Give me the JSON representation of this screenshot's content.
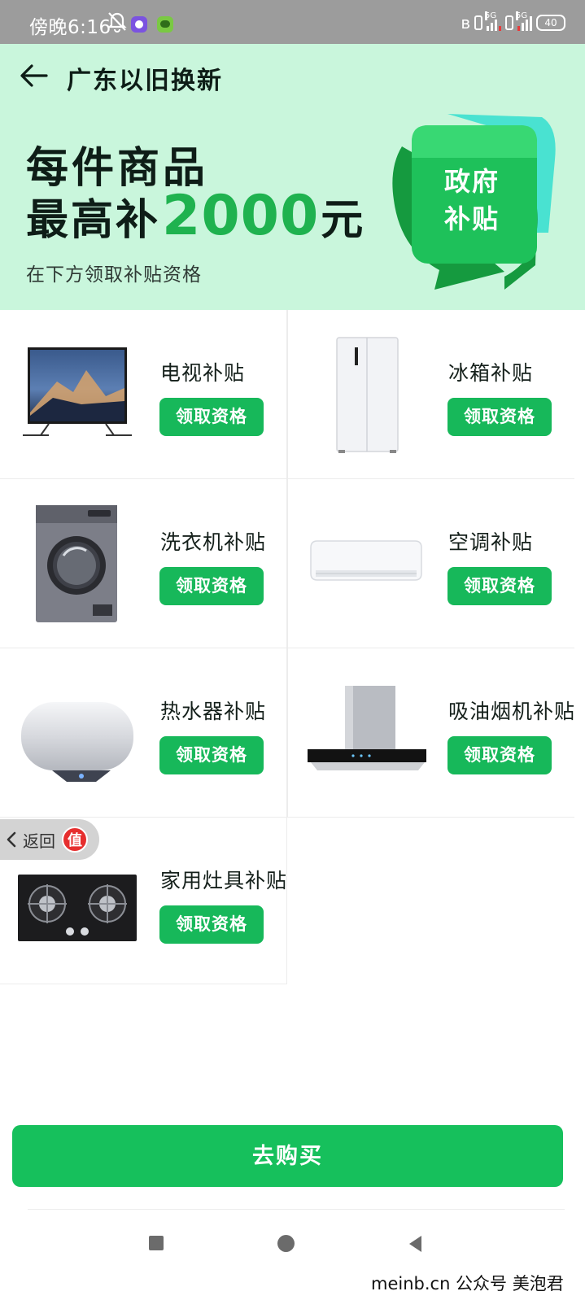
{
  "status_bar": {
    "time": "傍晚6:16",
    "network1": "5G",
    "network2": "5G",
    "battery": "40"
  },
  "header": {
    "title": "广东以旧换新"
  },
  "banner": {
    "line1": "每件商品",
    "line2_prefix": "最高补",
    "line2_amount": "2000",
    "line2_suffix": "元",
    "subtitle": "在下方领取补贴资格",
    "badge_line1": "政府",
    "badge_line2": "补贴",
    "accent_color": "#1fb24f"
  },
  "products": [
    {
      "title": "电视补贴",
      "button": "领取资格",
      "icon": "tv-icon"
    },
    {
      "title": "冰箱补贴",
      "button": "领取资格",
      "icon": "fridge-icon"
    },
    {
      "title": "洗衣机补贴",
      "button": "领取资格",
      "icon": "washer-icon"
    },
    {
      "title": "空调补贴",
      "button": "领取资格",
      "icon": "air-conditioner-icon"
    },
    {
      "title": "热水器补贴",
      "button": "领取资格",
      "icon": "water-heater-icon"
    },
    {
      "title": "吸油烟机补贴",
      "button": "领取资格",
      "icon": "range-hood-icon"
    },
    {
      "title": "家用灶具补贴",
      "button": "领取资格",
      "icon": "gas-stove-icon"
    }
  ],
  "floating_back": {
    "label": "返回",
    "logo_text": "值"
  },
  "cta": {
    "label": "去购买",
    "color": "#16c05c"
  },
  "watermark": "meinb.cn 公众号 美泡君"
}
